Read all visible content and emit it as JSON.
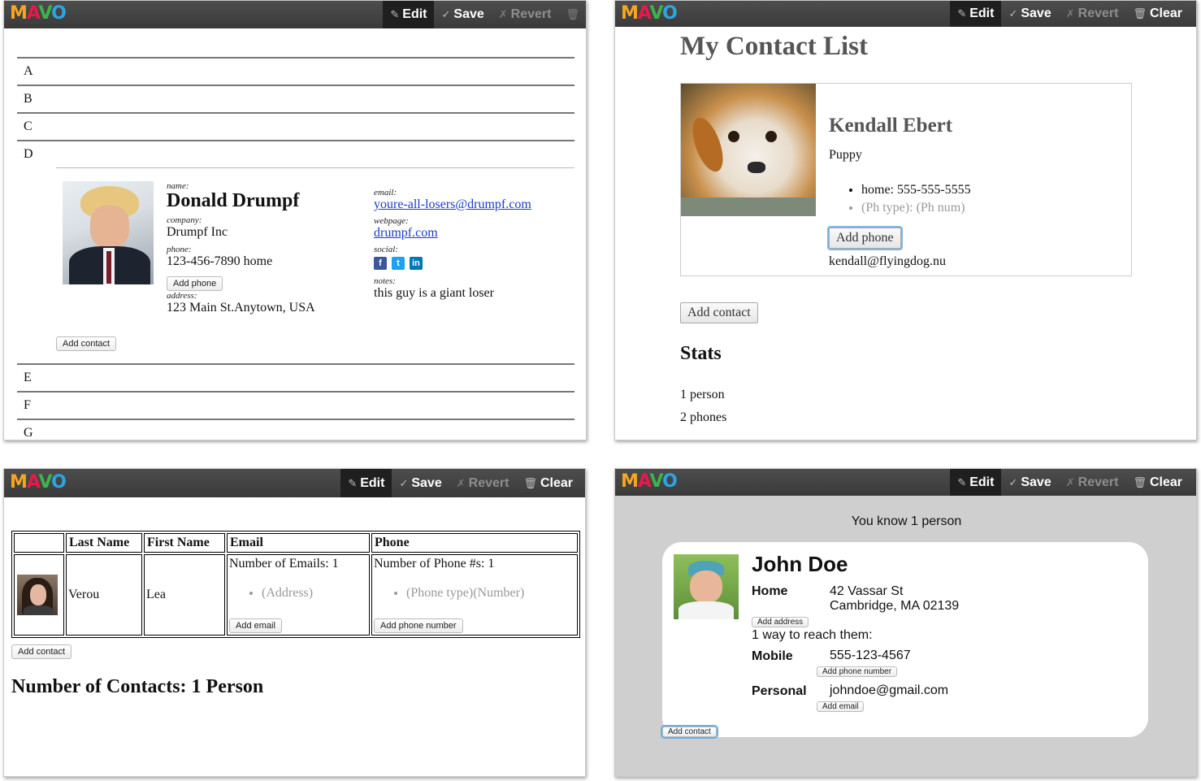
{
  "toolbar": {
    "logo_letters": [
      "M",
      "A",
      "V",
      "O"
    ],
    "edit": "Edit",
    "save": "Save",
    "revert": "Revert",
    "clear": "Clear"
  },
  "panel1": {
    "letters_top": [
      "A",
      "B",
      "C",
      "D"
    ],
    "letters_bottom": [
      "E",
      "F",
      "G"
    ],
    "contact": {
      "name_label": "name:",
      "name": "Donald Drumpf",
      "company_label": "company:",
      "company": "Drumpf Inc",
      "phone_label": "phone:",
      "phone": "123-456-7890 home",
      "add_phone": "Add phone",
      "address_label": "address:",
      "address": "123 Main St.Anytown, USA",
      "email_label": "email:",
      "email": "youre-all-losers@drumpf.com",
      "webpage_label": "webpage:",
      "webpage": "drumpf.com",
      "social_label": "social:",
      "notes_label": "notes:",
      "notes": "this guy is a giant loser"
    },
    "add_contact": "Add contact"
  },
  "panel2": {
    "title": "My Contact List",
    "contact": {
      "name": "Kendall Ebert",
      "subtitle": "Puppy",
      "phone_type": "home:",
      "phone_num": "555-555-5555",
      "ph_type_placeholder": "(Ph type)",
      "ph_num_placeholder": "(Ph num)",
      "add_phone": "Add phone",
      "email": "kendall@flyingdog.nu"
    },
    "add_contact": "Add contact",
    "stats_title": "Stats",
    "stat1": "1 person",
    "stat2": "2 phones"
  },
  "panel3": {
    "headers": [
      "",
      "Last Name",
      "First Name",
      "Email",
      "Phone"
    ],
    "row": {
      "last": "Verou",
      "first": "Lea",
      "emails_count": "Number of Emails: 1",
      "address_placeholder": "(Address)",
      "add_email": "Add email",
      "phones_count": "Number of Phone #s: 1",
      "phone_type_placeholder": "(Phone type)",
      "number_placeholder": "(Number)",
      "add_phone_number": "Add phone number"
    },
    "add_contact": "Add contact",
    "summary": "Number of Contacts: 1 Person"
  },
  "panel4": {
    "know": "You know 1 person",
    "name": "John Doe",
    "home_label": "Home",
    "address_line1": "42 Vassar St",
    "address_line2": "Cambridge, MA 02139",
    "add_address": "Add address",
    "ways": "1 way to reach them:",
    "mobile_label": "Mobile",
    "mobile": "555-123-4567",
    "add_phone_number": "Add phone number",
    "personal_label": "Personal",
    "email": "johndoe@gmail.com",
    "add_email": "Add email",
    "add_contact": "Add contact"
  }
}
